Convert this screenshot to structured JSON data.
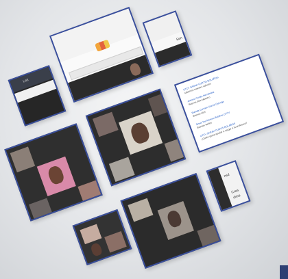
{
  "collage": {
    "top_tile": {
      "app_icon": "video-call-app-icon"
    },
    "top_right_tile": {
      "label": "Sen"
    },
    "left_small_tile": {
      "header_label": "Leti"
    },
    "chat_tile": {
      "messages": [
        {
          "name": "UTCV SARAH CURTIS BOLAÑOS",
          "time": "11:36",
          "text": "sabemos maestro saludos"
        },
        {
          "name": "Antonio Cortés Hernández",
          "time": "11:36",
          "text": "Buenos días Maestro"
        },
        {
          "name": "Brenda Carmen García Quiroga",
          "time": "11:38",
          "text": "Buenos días"
        },
        {
          "name": "Jesus Tos Moreno Bolaños UTCV",
          "time": "11:38",
          "text": "Buenas tardes"
        },
        {
          "name": "UTCV SARAH CURTIS BOLAÑOS",
          "time": "11:39",
          "text": "¿Quién gusta ayudar a cargar a la profesora?"
        }
      ]
    },
    "small_right_tile": {
      "labels": [
        "nsd",
        "Crea",
        "dime"
      ]
    },
    "colors": {
      "tile_border": "#3a4f9c",
      "dark_panel": "#2b2b2b",
      "corner_accent": "#2e3f73"
    }
  }
}
